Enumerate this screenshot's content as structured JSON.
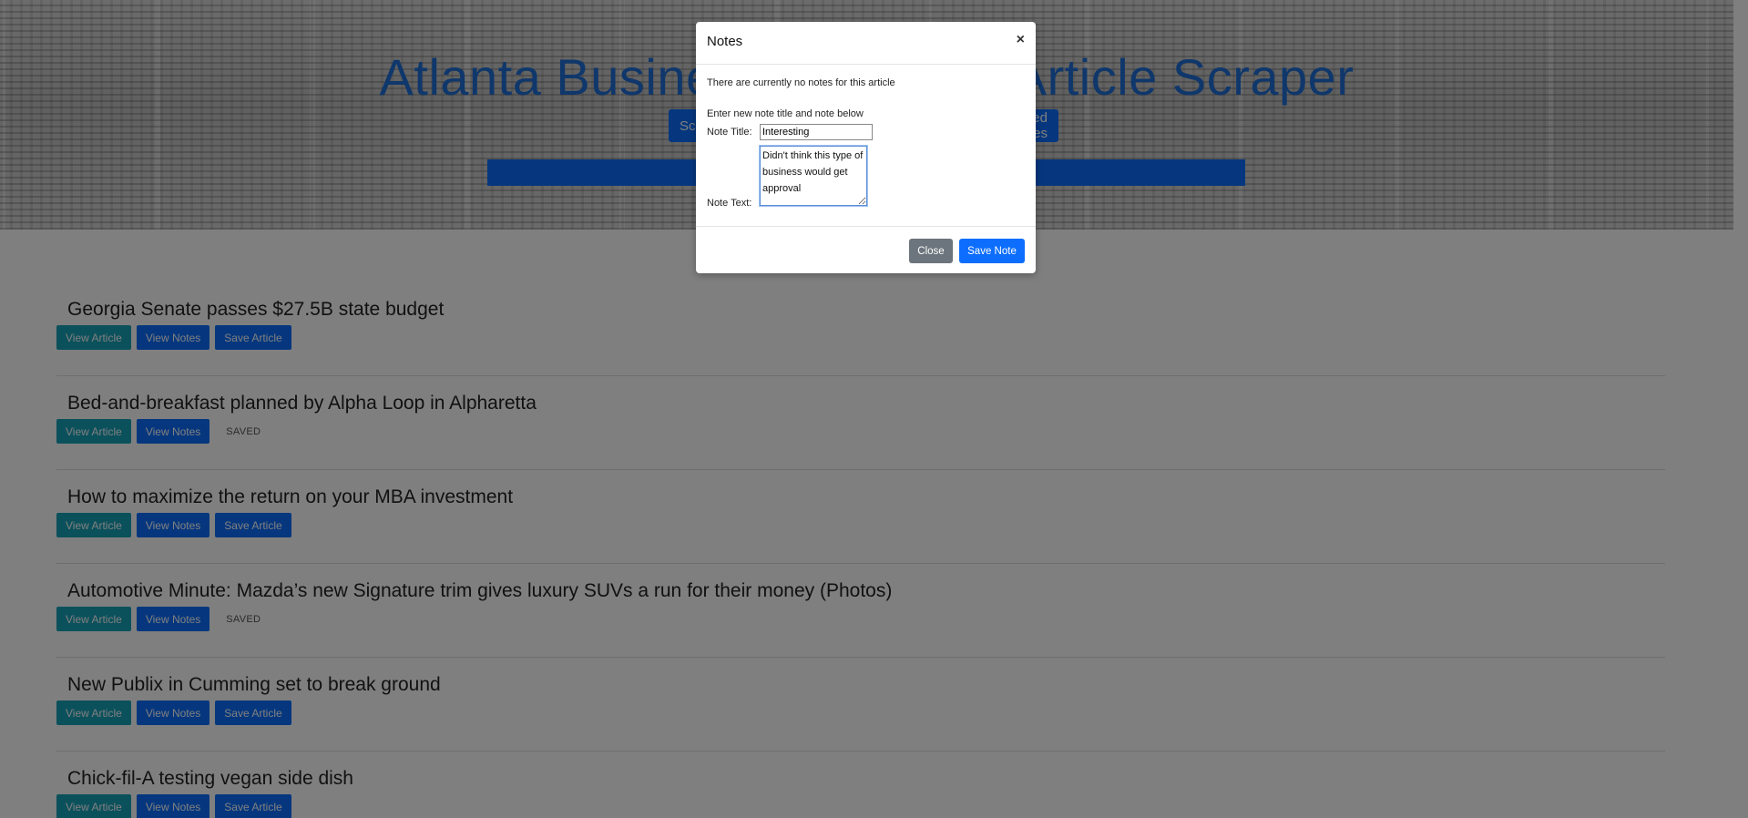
{
  "header": {
    "title": "Atlanta Business Chronicle Article Scraper",
    "buttons": [
      "Scrape Articles",
      "Saved Articles"
    ]
  },
  "articles": [
    {
      "title": "Georgia Senate passes $27.5B state budget",
      "saved": false
    },
    {
      "title": "Bed-and-breakfast planned by Alpha Loop in Alpharetta",
      "saved": true
    },
    {
      "title": "How to maximize the return on your MBA investment",
      "saved": false
    },
    {
      "title": "Automotive Minute: Mazda’s new Signature trim gives luxury SUVs a run for their money (Photos)",
      "saved": true
    },
    {
      "title": "New Publix in Cumming set to break ground",
      "saved": false
    },
    {
      "title": "Chick-fil-A testing vegan side dish",
      "saved": false
    }
  ],
  "article_labels": {
    "view_article": "View Article",
    "view_notes": "View Notes",
    "save_article": "Save Article",
    "saved": "SAVED"
  },
  "modal": {
    "title": "Notes",
    "close_symbol": "×",
    "no_notes": "There are currently no notes for this article",
    "instructions": "Enter new note title and note below",
    "title_label": "Note Title:",
    "title_value": "Interesting",
    "text_label": "Note Text:",
    "text_value": "Didn't think this type of business would get approval",
    "close_button": "Close",
    "save_button": "Save Note"
  },
  "colors": {
    "primary": "#0d6efd",
    "info": "#17a2b8",
    "secondary": "#6c757d",
    "title_blue": "#1f6fd6"
  }
}
